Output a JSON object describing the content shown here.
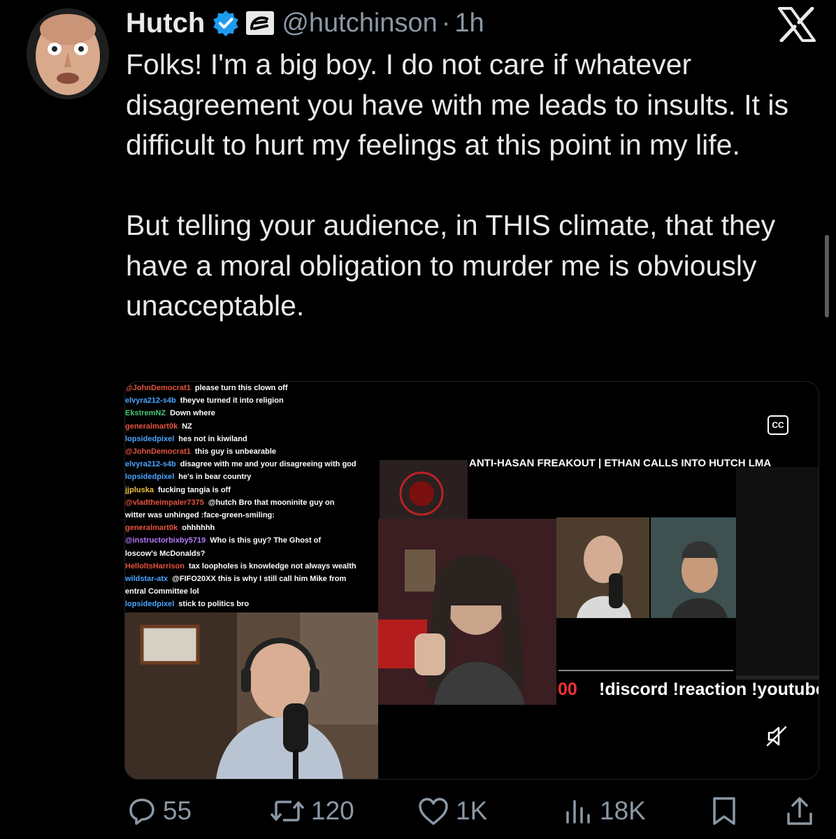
{
  "author": {
    "name": "Hutch",
    "handle": "@hutchinson",
    "separator": "·",
    "time": "1h"
  },
  "tweet": {
    "paragraph1": "Folks! I'm a big boy. I do not care if whatever disagreement you have with me leads to insults. It is difficult to hurt my feelings at this point in my life.",
    "paragraph2": "But telling your audience, in THIS climate, that they have a moral obligation to murder me is obviously unacceptable."
  },
  "video": {
    "banner": "ANTI-HASAN FREAKOUT | ETHAN CALLS INTO HUTCH LMA",
    "cc_label": "CC",
    "commands": "!discord !reaction !youtube",
    "commands_prefix": "00",
    "chat": [
      {
        "user": "@JohnDemocrat1",
        "msg": "please turn this clown off",
        "color": "#e5533d"
      },
      {
        "user": "elvyra212-s4b",
        "msg": "theyve turned it into religion",
        "color": "#4aa3ff"
      },
      {
        "user": "EkstremNZ",
        "msg": "Down where",
        "color": "#48c774"
      },
      {
        "user": "generalmart0k",
        "msg": "NZ",
        "color": "#e5533d"
      },
      {
        "user": "lopsidedpixel",
        "msg": "hes not in kiwiland",
        "color": "#4aa3ff"
      },
      {
        "user": "@JohnDemocrat1",
        "msg": "this guy is unbearable",
        "color": "#e5533d"
      },
      {
        "user": "elvyra212-s4b",
        "msg": "disagree with me and your disagreeing with god",
        "color": "#4aa3ff"
      },
      {
        "user": "lopsidedpixel",
        "msg": "he's in bear country",
        "color": "#4aa3ff"
      },
      {
        "user": "jjpluska",
        "msg": "fucking tangia is off",
        "color": "#f0c040"
      },
      {
        "user": "@vladtheimpaler7375",
        "msg": "@hutch Bro that mooninite guy on",
        "color": "#e5533d"
      },
      {
        "user": "",
        "msg": "witter was unhinged :face-green-smiling:",
        "color": "#fff"
      },
      {
        "user": "generalmart0k",
        "msg": "ohhhhhh",
        "color": "#e5533d"
      },
      {
        "user": "@instructorbixby5719",
        "msg": "Who is this guy? The Ghost of",
        "color": "#b57bff"
      },
      {
        "user": "",
        "msg": "loscow's McDonalds?",
        "color": "#fff"
      },
      {
        "user": "HelloltsHarrison",
        "msg": "tax loopholes is knowledge not always wealth",
        "color": "#e5533d"
      },
      {
        "user": "wildstar-atx",
        "msg": "@FIFO20XX this is why I still call him Mike from",
        "color": "#4aa3ff"
      },
      {
        "user": "",
        "msg": "entral Committee lol",
        "color": "#fff"
      },
      {
        "user": "lopsidedpixel",
        "msg": "stick to politics bro",
        "color": "#4aa3ff"
      }
    ]
  },
  "metrics": {
    "replies": "55",
    "reposts": "120",
    "likes": "1K",
    "views": "18K"
  },
  "colors": {
    "background": "#000000",
    "text": "#e7e9ea",
    "muted": "#8b98a5",
    "verified": "#1d9bf0"
  }
}
